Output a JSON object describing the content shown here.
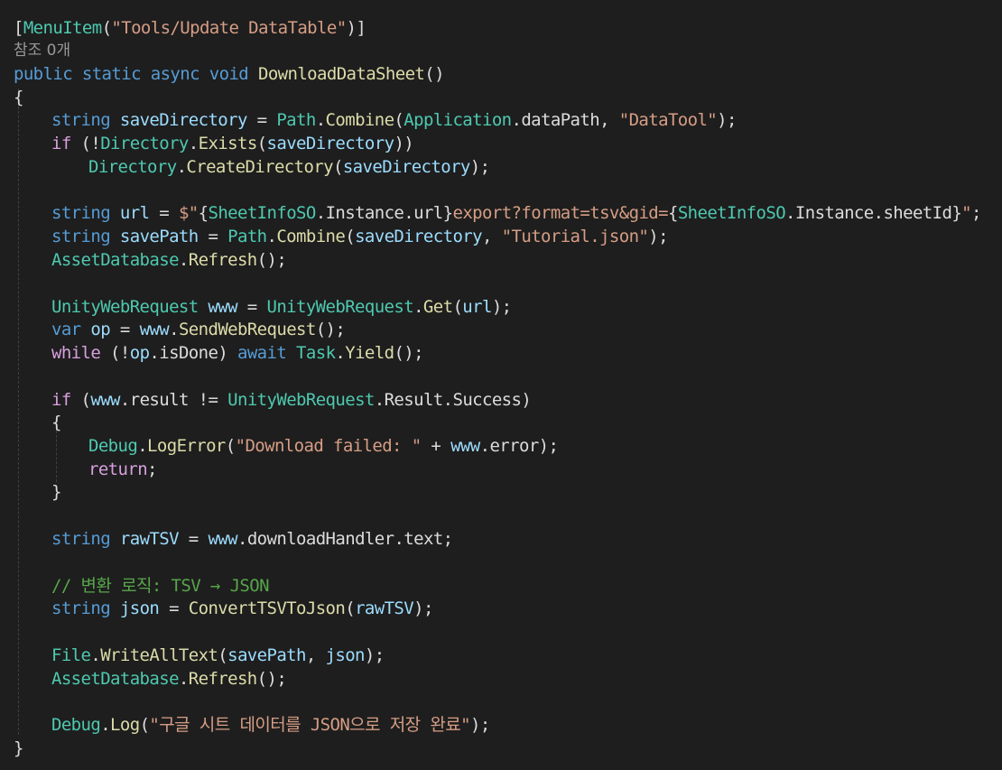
{
  "editor": {
    "attribute_line": {
      "open": "[",
      "attr": "MenuItem",
      "paren_open": "(",
      "arg": "\"Tools/Update DataTable\"",
      "close": ")]"
    },
    "codelens": "참조 0개",
    "signature": {
      "modifiers": "public static async void",
      "name": "DownloadDataSheet",
      "params": "()"
    },
    "brace_open": "{",
    "brace_close": "}",
    "stmt_save_dir": {
      "type": "string",
      "name": "saveDirectory",
      "eq": " = ",
      "cls": "Path",
      "dot": ".",
      "method": "Combine",
      "p1": "(",
      "cls2": "Application",
      "dot2": ".",
      "field": "dataPath",
      "sep": ", ",
      "str": "\"DataTool\"",
      "end": ");"
    },
    "stmt_if_exists": {
      "kw": "if",
      "open": " (!",
      "cls": "Directory",
      "dot": ".",
      "method": "Exists",
      "p1": "(",
      "arg": "saveDirectory",
      "end": "))"
    },
    "stmt_create_dir": {
      "cls": "Directory",
      "dot": ".",
      "method": "CreateDirectory",
      "p1": "(",
      "arg": "saveDirectory",
      "end": ");"
    },
    "stmt_url": {
      "type": "string",
      "name": "url",
      "eq": " = ",
      "s1": "$\"",
      "b1": "{",
      "cls1": "SheetInfoSO",
      "dot1": ".",
      "prop1": "Instance",
      "dot1b": ".",
      "prop1b": "url",
      "b1c": "}",
      "s2": "export?format=tsv&gid=",
      "b2": "{",
      "cls2": "SheetInfoSO",
      "dot2": ".",
      "prop2": "Instance",
      "dot2b": ".",
      "prop2b": "sheetId",
      "b2c": "}",
      "s3": "\"",
      "end": ";"
    },
    "stmt_save_path": {
      "type": "string",
      "name": "savePath",
      "eq": " = ",
      "cls": "Path",
      "dot": ".",
      "method": "Combine",
      "p1": "(",
      "arg": "saveDirectory",
      "sep": ", ",
      "str": "\"Tutorial.json\"",
      "end": ");"
    },
    "stmt_refresh1": {
      "cls": "AssetDatabase",
      "dot": ".",
      "method": "Refresh",
      "end": "();"
    },
    "stmt_www": {
      "cls": "UnityWebRequest",
      "name": " www",
      "eq": " = ",
      "cls2": "UnityWebRequest",
      "dot": ".",
      "method": "Get",
      "p1": "(",
      "arg": "url",
      "end": ");"
    },
    "stmt_op": {
      "kw": "var",
      "name": " op",
      "eq": " = ",
      "obj": "www",
      "dot": ".",
      "method": "SendWebRequest",
      "end": "();"
    },
    "stmt_while": {
      "kw": "while",
      "open": " (!",
      "obj": "op",
      "dot": ".",
      "prop": "isDone",
      "close": ") ",
      "kw2": "await",
      "sp": " ",
      "cls": "Task",
      "dot2": ".",
      "method": "Yield",
      "end": "();"
    },
    "stmt_if_result": {
      "kw": "if",
      "open": " (",
      "obj": "www",
      "dot": ".",
      "prop": "result",
      "op": " != ",
      "cls": "UnityWebRequest",
      "dot2": ".",
      "prop2": "Result",
      "dot3": ".",
      "prop3": "Success",
      "end": ")"
    },
    "stmt_log_error": {
      "cls": "Debug",
      "dot": ".",
      "method": "LogError",
      "p1": "(",
      "str": "\"Download failed: \"",
      "plus": " + ",
      "obj": "www",
      "dot2": ".",
      "prop": "error",
      "end": ");"
    },
    "stmt_return": {
      "kw": "return",
      "end": ";"
    },
    "stmt_raw": {
      "type": "string",
      "name": "rawTSV",
      "eq": " = ",
      "obj": "www",
      "dot": ".",
      "prop": "downloadHandler",
      "dot2": ".",
      "prop2": "text",
      "end": ";"
    },
    "comment": "// 변환 로직: TSV → JSON",
    "stmt_json": {
      "type": "string",
      "name": "json",
      "eq": " = ",
      "method": "ConvertTSVToJson",
      "p1": "(",
      "arg": "rawTSV",
      "end": ");"
    },
    "stmt_write": {
      "cls": "File",
      "dot": ".",
      "method": "WriteAllText",
      "p1": "(",
      "arg1": "savePath",
      "sep": ", ",
      "arg2": "json",
      "end": ");"
    },
    "stmt_refresh2": {
      "cls": "AssetDatabase",
      "dot": ".",
      "method": "Refresh",
      "end": "();"
    },
    "stmt_log": {
      "cls": "Debug",
      "dot": ".",
      "method": "Log",
      "p1": "(",
      "str": "\"구글 시트 데이터를 JSON으로 저장 완료\"",
      "end": ");"
    }
  },
  "colors": {
    "background": "#1e1e1e",
    "keyword": "#569cd6",
    "control_keyword": "#d8a0df",
    "type": "#4ec9b0",
    "method": "#dcdcaa",
    "string": "#d69d85",
    "variable": "#9cdcfe",
    "comment": "#57a64a",
    "text": "#dcdcdc"
  }
}
